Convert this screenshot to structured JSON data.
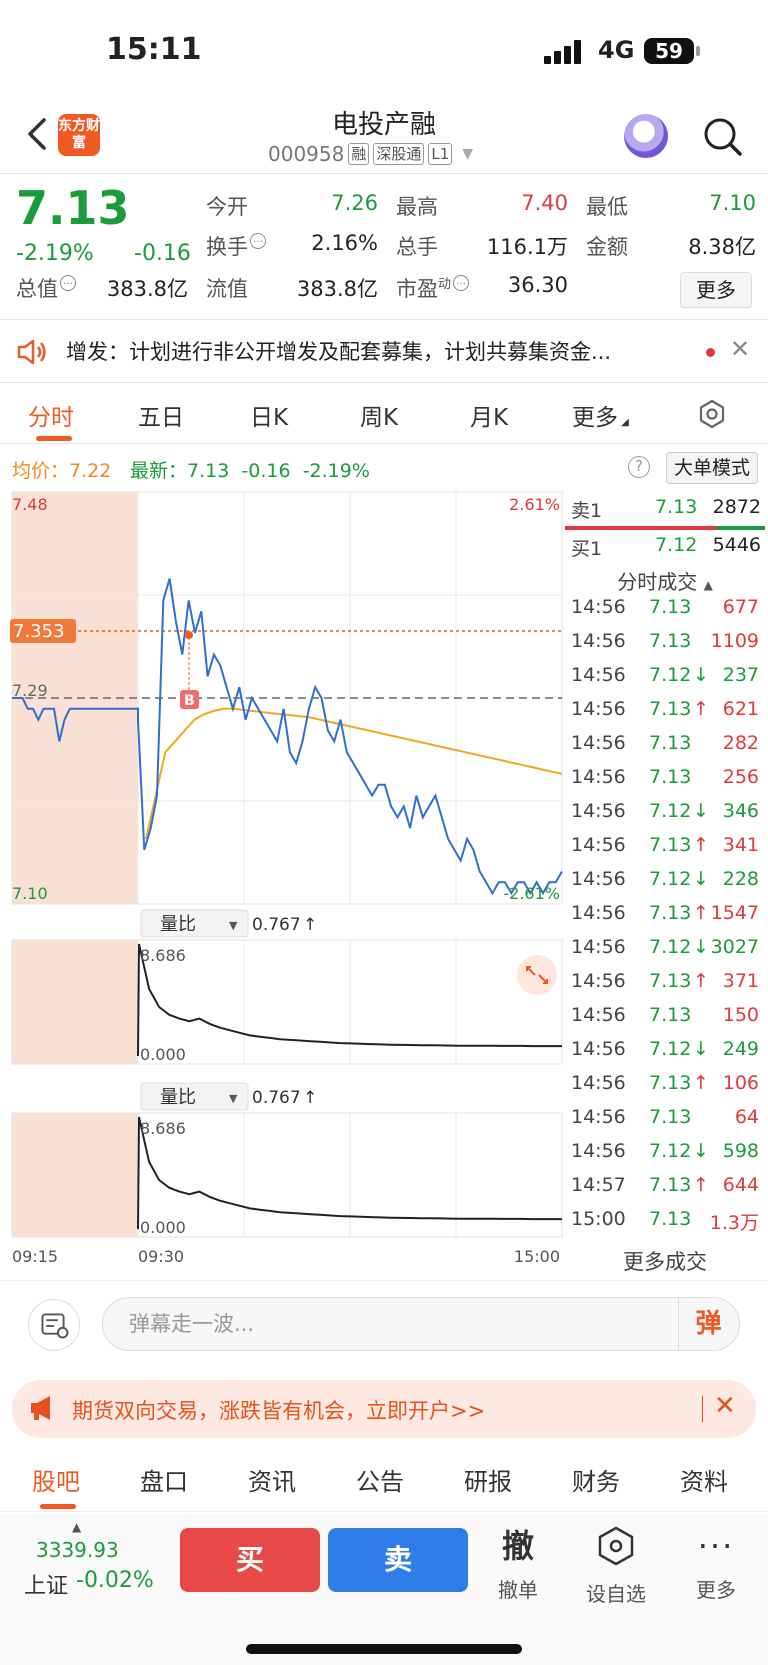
{
  "status_bar": {
    "time": "15:11",
    "network": "4G",
    "battery": "59"
  },
  "header": {
    "stock_name": "电投产融",
    "stock_code": "000958",
    "tags": [
      "融",
      "深股通",
      "L1"
    ],
    "logo_text": "东方财富"
  },
  "quote": {
    "price": "7.13",
    "change_pct": "-2.19%",
    "change": "-0.16",
    "fields": {
      "open_label": "今开",
      "open": "7.26",
      "high_label": "最高",
      "high": "7.40",
      "low_label": "最低",
      "low": "7.10",
      "turnover_label": "换手",
      "turnover": "2.16%",
      "volume_label": "总手",
      "volume": "116.1万",
      "amount_label": "金额",
      "amount": "8.38亿",
      "mktcap_label": "总值",
      "mktcap": "383.8亿",
      "float_label": "流值",
      "float": "383.8亿",
      "pe_label": "市盈",
      "pe_sup": "动",
      "pe": "36.30"
    },
    "more_label": "更多"
  },
  "notice": {
    "text": "增发：计划进行非公开增发及配套募集，计划共募集资金..."
  },
  "period_tabs": [
    "分时",
    "五日",
    "日K",
    "周K",
    "月K",
    "更多"
  ],
  "chart_info": {
    "avg_label": "均价：",
    "avg_value": "7.22",
    "latest_label": "最新：",
    "latest_value": "7.13",
    "latest_change": "-0.16",
    "latest_pct": "-2.19%",
    "big_order_mode": "大单模式"
  },
  "colors": {
    "accent": "#f05a22",
    "up": "#e03a3a",
    "down": "#1a9c3a",
    "avg_line": "#f5a623",
    "price_line": "#2f6fd0"
  },
  "chart_data": [
    {
      "type": "line",
      "title": "",
      "y_left_ticks": [
        "7.48",
        "7.29",
        "7.10"
      ],
      "y_right_ticks": [
        "2.61%",
        "-2.61%"
      ],
      "x_ticks": [
        "09:15",
        "09:30",
        "15:00"
      ],
      "ylim": [
        7.1,
        7.48
      ],
      "prev_close": 7.29,
      "marked_price": "7.353",
      "marker_label": "B",
      "series": [
        {
          "name": "",
          "kind": "price",
          "values": [
            7.29,
            7.29,
            7.29,
            7.28,
            7.28,
            7.27,
            7.28,
            7.28,
            7.28,
            7.25,
            7.27,
            7.28,
            7.28,
            7.28,
            7.28,
            7.28,
            7.28,
            7.28,
            7.28,
            7.28,
            7.28,
            7.28,
            7.28,
            7.28,
            7.28,
            7.27,
            7.15,
            7.17,
            7.2,
            7.38,
            7.4,
            7.36,
            7.33,
            7.38,
            7.35,
            7.37,
            7.31,
            7.33,
            7.32,
            7.3,
            7.28,
            7.3,
            7.27,
            7.29,
            7.28,
            7.27,
            7.26,
            7.25,
            7.28,
            7.24,
            7.23,
            7.25,
            7.28,
            7.3,
            7.29,
            7.26,
            7.25,
            7.27,
            7.24,
            7.23,
            7.22,
            7.21,
            7.2,
            7.21,
            7.21,
            7.19,
            7.18,
            7.19,
            7.17,
            7.2,
            7.18,
            7.19,
            7.2,
            7.18,
            7.16,
            7.15,
            7.14,
            7.16,
            7.15,
            7.13,
            7.12,
            7.11,
            7.12,
            7.12,
            7.11,
            7.12,
            7.12,
            7.11,
            7.12,
            7.11,
            7.12,
            7.12,
            7.13
          ]
        },
        {
          "name": "",
          "kind": "avg",
          "values": [
            7.16,
            7.2,
            7.24,
            7.25,
            7.26,
            7.27,
            7.275,
            7.278,
            7.28,
            7.28,
            7.279,
            7.278,
            7.277,
            7.276,
            7.275,
            7.274,
            7.273,
            7.272,
            7.27,
            7.268,
            7.266,
            7.264,
            7.262,
            7.26,
            7.258,
            7.256,
            7.254,
            7.252,
            7.25,
            7.248,
            7.246,
            7.244,
            7.242,
            7.24,
            7.238,
            7.236,
            7.234,
            7.232,
            7.23,
            7.228,
            7.226,
            7.224,
            7.222,
            7.22
          ]
        }
      ]
    },
    {
      "type": "line",
      "title": "量比",
      "indicator_value": "0.767",
      "y_ticks": [
        "8.686",
        "0.000"
      ],
      "ylim": [
        0,
        8.686
      ],
      "series": [
        {
          "name": "",
          "values": [
            8.686,
            5.2,
            3.8,
            3.2,
            2.9,
            2.7,
            2.9,
            2.5,
            2.2,
            2.0,
            1.8,
            1.6,
            1.5,
            1.4,
            1.3,
            1.25,
            1.2,
            1.15,
            1.1,
            1.05,
            1.0,
            0.98,
            0.95,
            0.92,
            0.9,
            0.88,
            0.86,
            0.85,
            0.84,
            0.83,
            0.82,
            0.81,
            0.8,
            0.8,
            0.79,
            0.79,
            0.78,
            0.78,
            0.78,
            0.77,
            0.77,
            0.77,
            0.767
          ]
        }
      ]
    },
    {
      "type": "line",
      "title": "量比",
      "indicator_value": "0.767",
      "y_ticks": [
        "8.686",
        "0.000"
      ],
      "ylim": [
        0,
        8.686
      ],
      "series": [
        {
          "name": "",
          "values": [
            8.686,
            5.2,
            3.8,
            3.2,
            2.9,
            2.7,
            2.9,
            2.5,
            2.2,
            2.0,
            1.8,
            1.6,
            1.5,
            1.4,
            1.3,
            1.25,
            1.2,
            1.15,
            1.1,
            1.05,
            1.0,
            0.98,
            0.95,
            0.92,
            0.9,
            0.88,
            0.86,
            0.85,
            0.84,
            0.83,
            0.82,
            0.81,
            0.8,
            0.8,
            0.79,
            0.79,
            0.78,
            0.78,
            0.78,
            0.77,
            0.77,
            0.77,
            0.767
          ]
        }
      ]
    }
  ],
  "order_book": {
    "sell1": {
      "label": "卖1",
      "price": "7.13",
      "vol": "2872"
    },
    "buy1": {
      "label": "买1",
      "price": "7.12",
      "vol": "5446"
    }
  },
  "trades_title": "分时成交",
  "trades": [
    {
      "time": "14:56",
      "price": "7.13",
      "dir": "",
      "vol": "677",
      "side": "up"
    },
    {
      "time": "14:56",
      "price": "7.13",
      "dir": "",
      "vol": "1109",
      "side": "up"
    },
    {
      "time": "14:56",
      "price": "7.12",
      "dir": "↓",
      "vol": "237",
      "side": "down"
    },
    {
      "time": "14:56",
      "price": "7.13",
      "dir": "↑",
      "vol": "621",
      "side": "up"
    },
    {
      "time": "14:56",
      "price": "7.13",
      "dir": "",
      "vol": "282",
      "side": "up"
    },
    {
      "time": "14:56",
      "price": "7.13",
      "dir": "",
      "vol": "256",
      "side": "up"
    },
    {
      "time": "14:56",
      "price": "7.12",
      "dir": "↓",
      "vol": "346",
      "side": "down"
    },
    {
      "time": "14:56",
      "price": "7.13",
      "dir": "↑",
      "vol": "341",
      "side": "up"
    },
    {
      "time": "14:56",
      "price": "7.12",
      "dir": "↓",
      "vol": "228",
      "side": "down"
    },
    {
      "time": "14:56",
      "price": "7.13",
      "dir": "↑",
      "vol": "1547",
      "side": "up"
    },
    {
      "time": "14:56",
      "price": "7.12",
      "dir": "↓",
      "vol": "3027",
      "side": "down"
    },
    {
      "time": "14:56",
      "price": "7.13",
      "dir": "↑",
      "vol": "371",
      "side": "up"
    },
    {
      "time": "14:56",
      "price": "7.13",
      "dir": "",
      "vol": "150",
      "side": "up"
    },
    {
      "time": "14:56",
      "price": "7.12",
      "dir": "↓",
      "vol": "249",
      "side": "down"
    },
    {
      "time": "14:56",
      "price": "7.13",
      "dir": "↑",
      "vol": "106",
      "side": "up"
    },
    {
      "time": "14:56",
      "price": "7.13",
      "dir": "",
      "vol": "64",
      "side": "up"
    },
    {
      "time": "14:56",
      "price": "7.12",
      "dir": "↓",
      "vol": "598",
      "side": "down"
    },
    {
      "time": "14:57",
      "price": "7.13",
      "dir": "↑",
      "vol": "644",
      "side": "up"
    },
    {
      "time": "15:00",
      "price": "7.13",
      "dir": "",
      "vol": "1.3万",
      "side": "up"
    }
  ],
  "more_trades": "更多成交",
  "danmaku": {
    "placeholder": "弹幕走一波...",
    "send": "弹"
  },
  "ad": {
    "text": "期货双向交易，涨跌皆有机会，立即开户>>"
  },
  "bottom_tabs": [
    "股吧",
    "盘口",
    "资讯",
    "公告",
    "研报",
    "财务",
    "资料"
  ],
  "footer": {
    "index_value": "3339.93",
    "index_name": "上证",
    "index_change": "-0.02%",
    "buy": "买",
    "sell": "卖",
    "cancel_icon_char": "撤",
    "cancel": "撤单",
    "watchlist": "设自选",
    "more": "更多"
  }
}
